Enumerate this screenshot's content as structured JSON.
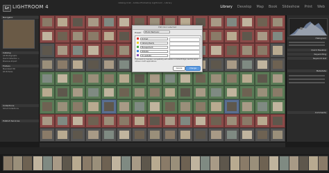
{
  "app": {
    "badge": "Lr",
    "name": "LIGHTROOM 4",
    "window_title": "catalog.lrcat - Adobe Photoshop Lightroom - Library"
  },
  "modules": [
    {
      "label": "Library",
      "active": true
    },
    {
      "label": "Develop",
      "active": false
    },
    {
      "label": "Map",
      "active": false
    },
    {
      "label": "Book",
      "active": false
    },
    {
      "label": "Slideshow",
      "active": false
    },
    {
      "label": "Print",
      "active": false
    },
    {
      "label": "Web",
      "active": false
    }
  ],
  "left_panel": {
    "navigator": "Navigator",
    "sections": [
      "Catalog",
      "Folders",
      "Collections",
      "Publish Services"
    ],
    "rows": [
      "All Photographs",
      "Quick Collection +",
      "Previous Import",
      "Macintosh HD",
      "LR Pictures",
      "Smart Collections"
    ]
  },
  "right_panel": {
    "sections": [
      "Histogram",
      "Quick Develop",
      "Keywording",
      "Keyword List",
      "Metadata",
      "Comments"
    ]
  },
  "dialog": {
    "title": "Edit Color Label Set",
    "preset_label": "Preset:",
    "preset_value": "Photo Mechanic",
    "labels": [
      {
        "name": "Portrait",
        "color": "#e0342c"
      },
      {
        "name": "Catalog Ready",
        "color": "#f0d22a"
      },
      {
        "name": "Management",
        "color": "#4fae48"
      },
      {
        "name": "Website",
        "color": "#3d7fd8"
      },
      {
        "name": "On website",
        "color": "#8a4fb8"
      }
    ],
    "note": "If you wish to maintain compatibility with labels in Adobe Bridge, use the same names in both applications.",
    "cancel": "Cancel",
    "change": "Change"
  },
  "colors": {
    "red_label": "#8a4a48",
    "green_label": "#5a7a56",
    "blue_label": "#5a6f90",
    "neutral": "#555555"
  }
}
